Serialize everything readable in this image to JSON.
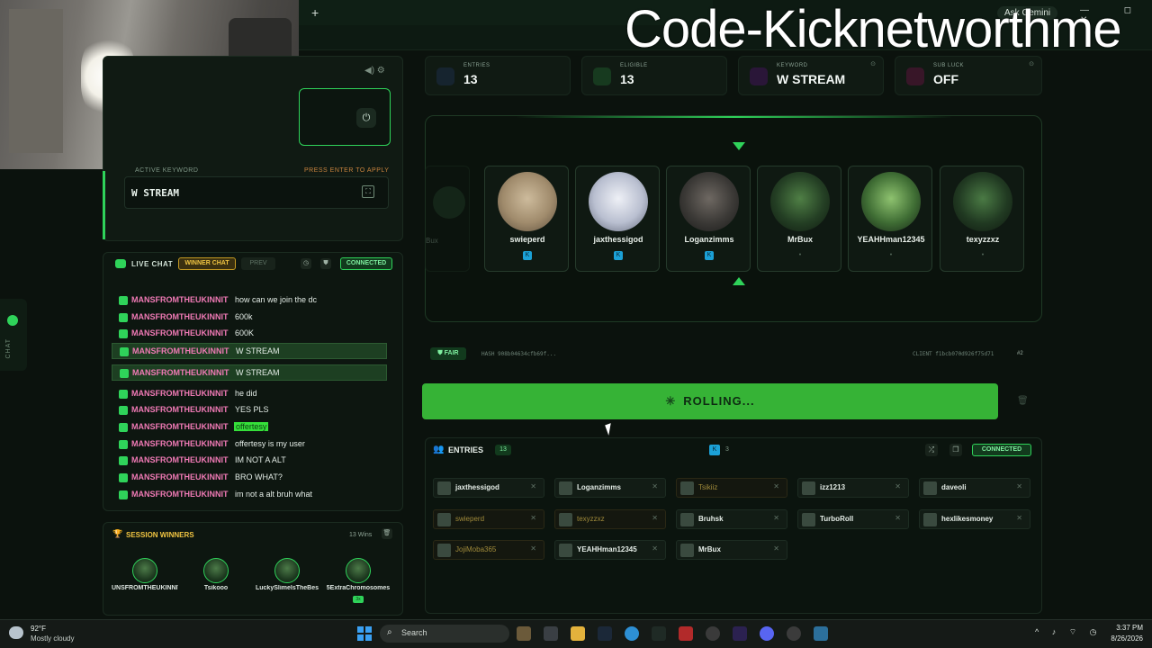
{
  "browser": {
    "new_tab_label": "+",
    "ask_gemini": "Ask Gemini",
    "window_controls": "— ◻ ✕"
  },
  "stream_overlay": {
    "text": "Code-Kicknetworthme"
  },
  "sidebar_tab": {
    "label": "CHAT"
  },
  "keyword_panel": {
    "active_label": "ACTIVE KEYWORD",
    "hint": "PRESS ENTER TO APPLY",
    "value": "W STREAM"
  },
  "chat": {
    "live_label": "LIVE CHAT",
    "tab_winner": "WINNER CHAT",
    "tab_prev": "PREV",
    "status": "CONNECTED",
    "messages": [
      {
        "user": "MANSFROMTHEUKINNIT",
        "text": "how can we join the dc",
        "highlight": false,
        "marked": false
      },
      {
        "user": "MANSFROMTHEUKINNIT",
        "text": "600k",
        "highlight": false,
        "marked": false
      },
      {
        "user": "MANSFROMTHEUKINNIT",
        "text": "600K",
        "highlight": false,
        "marked": false
      },
      {
        "user": "MANSFROMTHEUKINNIT",
        "text": "W STREAM",
        "highlight": true,
        "marked": false
      },
      {
        "user": "MANSFROMTHEUKINNIT",
        "text": "W STREAM",
        "highlight": true,
        "marked": false
      },
      {
        "user": "MANSFROMTHEUKINNIT",
        "text": "he did",
        "highlight": false,
        "marked": false
      },
      {
        "user": "MANSFROMTHEUKINNIT",
        "text": "YES PLS",
        "highlight": false,
        "marked": false
      },
      {
        "user": "MANSFROMTHEUKINNIT",
        "text": "offertesy",
        "highlight": false,
        "marked": true
      },
      {
        "user": "MANSFROMTHEUKINNIT",
        "text": "offertesy is my user",
        "highlight": false,
        "marked": false
      },
      {
        "user": "MANSFROMTHEUKINNIT",
        "text": "IM NOT A ALT",
        "highlight": false,
        "marked": false
      },
      {
        "user": "MANSFROMTHEUKINNIT",
        "text": "BRO WHAT?",
        "highlight": false,
        "marked": false
      },
      {
        "user": "MANSFROMTHEUKINNIT",
        "text": "im not a alt bruh what",
        "highlight": false,
        "marked": false
      }
    ]
  },
  "session_winners": {
    "title": "SESSION WINNERS",
    "count": "13 Wins",
    "winners": [
      {
        "name": "UNSFROMTHEUKINNIT",
        "badge": ""
      },
      {
        "name": "Tsikooo",
        "badge": ""
      },
      {
        "name": "LuckySlimelsTheBes",
        "badge": ""
      },
      {
        "name": "5ExtraChromosomes",
        "badge": "3x"
      }
    ]
  },
  "stats": {
    "entries": {
      "label": "ENTRIES",
      "value": "13"
    },
    "eligible": {
      "label": "ELIGIBLE",
      "value": "13"
    },
    "keyword": {
      "label": "KEYWORD",
      "value": "W STREAM"
    },
    "sub_luck": {
      "label": "SUB LUCK",
      "value": "OFF"
    }
  },
  "roulette": {
    "ghost_name": "Bux",
    "cards": [
      {
        "name": "swieperd",
        "kick": true
      },
      {
        "name": "jaxthessigod",
        "kick": true
      },
      {
        "name": "Loganzimms",
        "kick": true
      },
      {
        "name": "MrBux",
        "kick": false
      },
      {
        "name": "YEAHHman12345",
        "kick": false
      },
      {
        "name": "texyzzxz",
        "kick": false
      }
    ]
  },
  "fairness": {
    "badge": "FAIR",
    "hash": "HASH 908b04634cfb69f...",
    "client": "CLIENT f1bcb070d926f75d71",
    "nonce": "#2"
  },
  "roll": {
    "label": "ROLLING..."
  },
  "entries_panel": {
    "title": "ENTRIES",
    "count": "13",
    "kick_count": "3",
    "status": "CONNECTED",
    "items": [
      {
        "name": "jaxthessigod",
        "dim": false
      },
      {
        "name": "Loganzimms",
        "dim": false
      },
      {
        "name": "Tsikiiz",
        "dim": true
      },
      {
        "name": "izz1213",
        "dim": false
      },
      {
        "name": "daveoli",
        "dim": false
      },
      {
        "name": "swieperd",
        "dim": true
      },
      {
        "name": "texyzzxz",
        "dim": true
      },
      {
        "name": "Bruhsk",
        "dim": false
      },
      {
        "name": "TurboRoll",
        "dim": false
      },
      {
        "name": "hexlikesmoney",
        "dim": false
      },
      {
        "name": "JojiMoba365",
        "dim": true
      },
      {
        "name": "YEAHHman12345",
        "dim": false
      },
      {
        "name": "MrBux",
        "dim": false
      }
    ]
  },
  "taskbar": {
    "weather_temp": "92°F",
    "weather_desc": "Mostly cloudy",
    "search_placeholder": "Search",
    "time": "3:37 PM",
    "date": "8/26/2026"
  }
}
